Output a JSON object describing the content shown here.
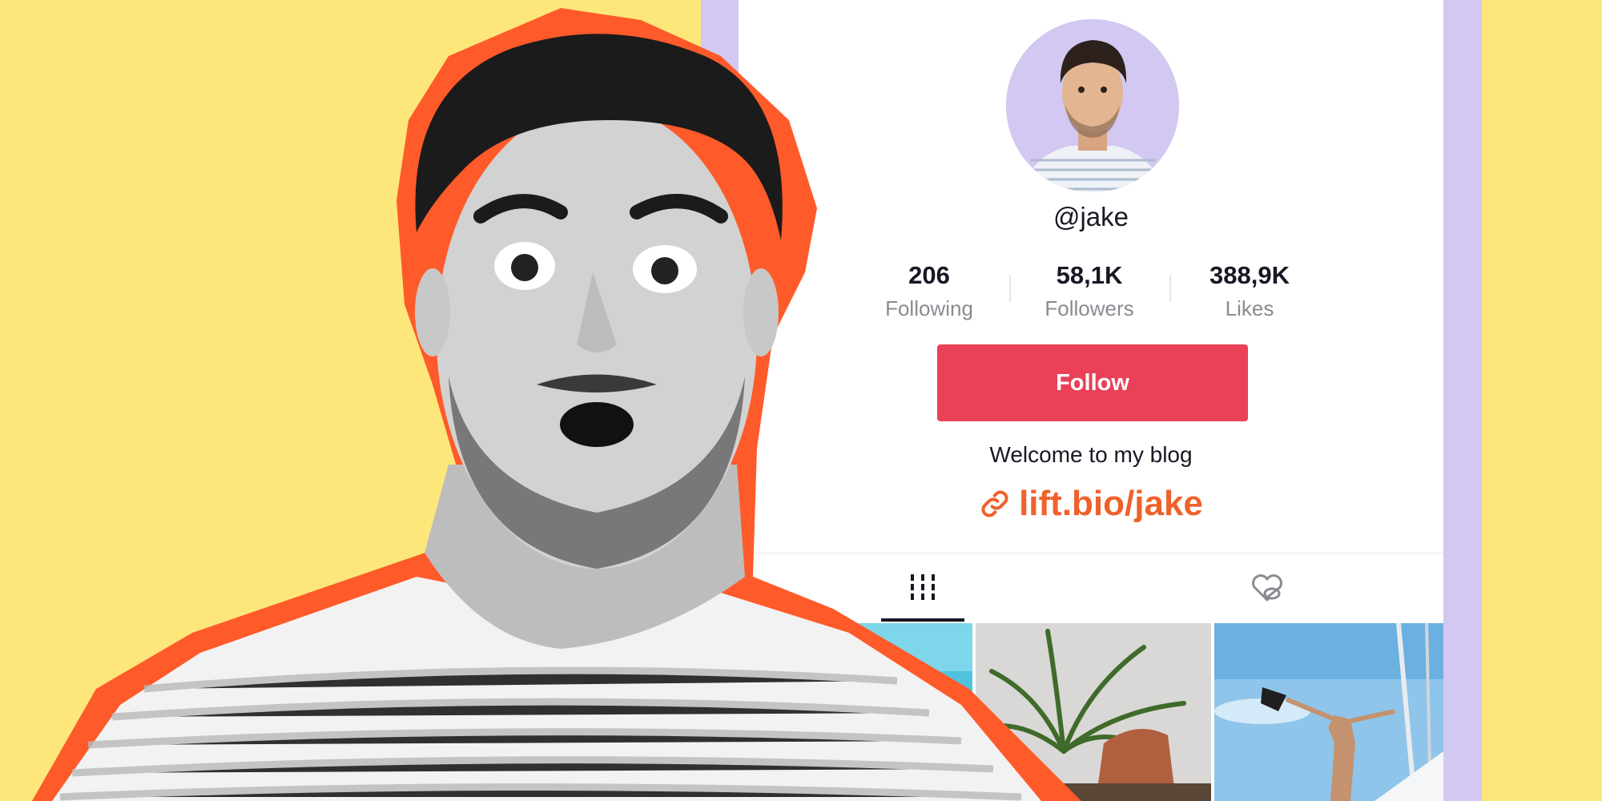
{
  "profile": {
    "username": "@jake",
    "stats": [
      {
        "value": "206",
        "label": "Following"
      },
      {
        "value": "58,1K",
        "label": "Followers"
      },
      {
        "value": "388,9K",
        "label": "Likes"
      }
    ],
    "follow_label": "Follow",
    "bio": "Welcome to my blog",
    "link": "lift.bio/jake"
  },
  "tabs": [
    {
      "icon": "grid-icon",
      "active": true
    },
    {
      "icon": "liked-hidden-icon",
      "active": false
    }
  ],
  "colors": {
    "background": "#fde77a",
    "lavender": "#d2c8f1",
    "follow_button": "#ea4058",
    "link": "#f0612a",
    "outline": "#ff5a2a"
  }
}
